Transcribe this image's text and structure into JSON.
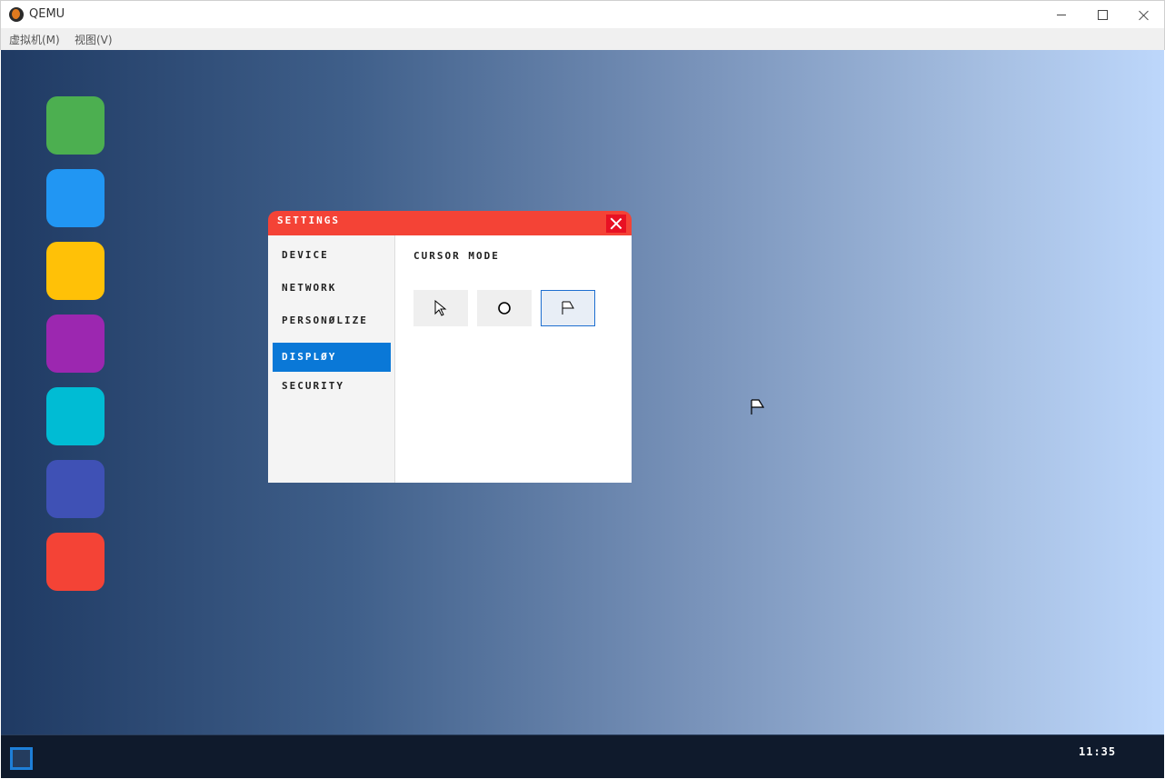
{
  "window": {
    "title": "QEMU",
    "menu": [
      "虚拟机(M)",
      "视图(V)"
    ]
  },
  "dock": {
    "icons": [
      {
        "name": "green-app-icon",
        "color": "#4caf50"
      },
      {
        "name": "blue-app-icon",
        "color": "#2196f3"
      },
      {
        "name": "yellow-app-icon",
        "color": "#ffc107"
      },
      {
        "name": "purple-app-icon",
        "color": "#9c27b0"
      },
      {
        "name": "cyan-app-icon",
        "color": "#00bcd4"
      },
      {
        "name": "indigo-app-icon",
        "color": "#3f51b5"
      },
      {
        "name": "red-app-icon",
        "color": "#f44336"
      }
    ]
  },
  "settings": {
    "title": "SETTINGS",
    "title_color": "#f44336",
    "sidebar": [
      {
        "label": "DEVICE",
        "active": false
      },
      {
        "label": "NETWORK",
        "active": false
      },
      {
        "label": "PERSONØLIZE",
        "active": false
      },
      {
        "label": "DISPLØY",
        "active": true
      },
      {
        "label": "SECURITY",
        "active": false
      }
    ],
    "content": {
      "heading": "CURSOR MODE",
      "modes": [
        {
          "icon": "arrow-cursor-icon",
          "selected": false
        },
        {
          "icon": "circle-cursor-icon",
          "selected": false
        },
        {
          "icon": "flag-cursor-icon",
          "selected": true
        }
      ]
    }
  },
  "taskbar": {
    "clock": "11:35",
    "accent": "#1e7fd8"
  }
}
